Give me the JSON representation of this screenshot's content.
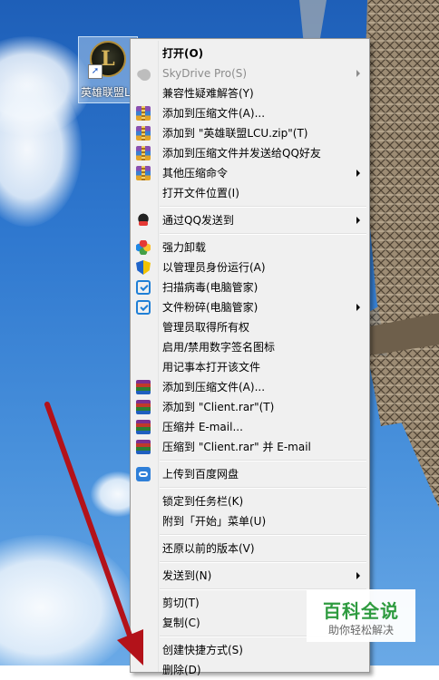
{
  "desktop_icon": {
    "label": "英雄联盟LCU",
    "glyph": "L"
  },
  "menu": {
    "items": [
      {
        "label": "打开(O)",
        "icon": "none"
      },
      {
        "label": "SkyDrive Pro(S)",
        "icon": "skydrive-cloud-icon"
      },
      {
        "label": "兼容性疑难解答(Y)",
        "icon": "none"
      },
      {
        "label": "添加到压缩文件(A)...",
        "icon": "winrar-zip-icon"
      },
      {
        "label": "添加到 \"英雄联盟LCU.zip\"(T)",
        "icon": "winrar-zip-icon"
      },
      {
        "label": "添加到压缩文件并发送给QQ好友",
        "icon": "winrar-zip-icon"
      },
      {
        "label": "其他压缩命令",
        "icon": "winrar-zip-icon"
      },
      {
        "label": "打开文件位置(I)",
        "icon": "none"
      },
      {
        "label": "通过QQ发送到",
        "icon": "qq-penguin-icon"
      },
      {
        "label": "强力卸载",
        "icon": "flower-icon"
      },
      {
        "label": "以管理员身份运行(A)",
        "icon": "uac-shield-icon"
      },
      {
        "label": "扫描病毒(电脑管家)",
        "icon": "pc-manager-icon"
      },
      {
        "label": "文件粉碎(电脑管家)",
        "icon": "pc-manager-icon"
      },
      {
        "label": "管理员取得所有权",
        "icon": "none"
      },
      {
        "label": "启用/禁用数字签名图标",
        "icon": "none"
      },
      {
        "label": "用记事本打开该文件",
        "icon": "none"
      },
      {
        "label": "添加到压缩文件(A)...",
        "icon": "winrar-books-icon"
      },
      {
        "label": "添加到 \"Client.rar\"(T)",
        "icon": "winrar-books-icon"
      },
      {
        "label": "压缩并 E-mail...",
        "icon": "winrar-books-icon"
      },
      {
        "label": "压缩到 \"Client.rar\" 并 E-mail",
        "icon": "winrar-books-icon"
      },
      {
        "label": "上传到百度网盘",
        "icon": "baidu-netdisk-icon"
      },
      {
        "label": "锁定到任务栏(K)",
        "icon": "none"
      },
      {
        "label": "附到「开始」菜单(U)",
        "icon": "none"
      },
      {
        "label": "还原以前的版本(V)",
        "icon": "none"
      },
      {
        "label": "发送到(N)",
        "icon": "none"
      },
      {
        "label": "剪切(T)",
        "icon": "none"
      },
      {
        "label": "复制(C)",
        "icon": "none"
      },
      {
        "label": "创建快捷方式(S)",
        "icon": "none"
      },
      {
        "label": "删除(D)",
        "icon": "none"
      }
    ]
  },
  "watermark": {
    "title": "百科全说",
    "subtitle": "助你轻松解决"
  },
  "colors": {
    "menu_bg": "#f0f0f0",
    "annotation_arrow": "#b3121a",
    "sky": "#2f78cf"
  }
}
